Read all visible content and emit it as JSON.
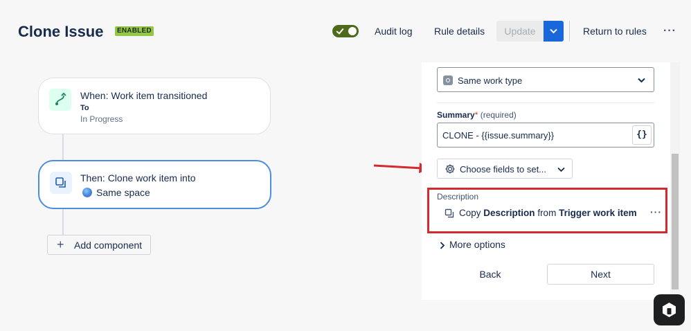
{
  "header": {
    "title": "Clone Issue",
    "status_badge": "ENABLED",
    "toggle_on": true,
    "audit_log": "Audit log",
    "rule_details": "Rule details",
    "update": "Update",
    "return_to_rules": "Return to rules",
    "more": "···"
  },
  "flow": {
    "trigger": {
      "title": "When: Work item transitioned",
      "sub_label": "To",
      "sub_value": "In Progress",
      "icon": "transition-icon"
    },
    "action": {
      "title": "Then: Clone work item into",
      "target": "Same space",
      "icon": "clone-icon"
    },
    "add_component": "Add component"
  },
  "panel": {
    "work_type": {
      "value": "Same work type"
    },
    "summary": {
      "label": "Summary",
      "required_star": "*",
      "required_text": "(required)",
      "value": "CLONE - {{issue.summary}}",
      "braces": "{}"
    },
    "choose_fields": "Choose fields to set...",
    "description": {
      "label": "Description",
      "copy": "Copy",
      "field": "Description",
      "from": "from",
      "source": "Trigger work item",
      "more": "···"
    },
    "more_options": "More options",
    "back": "Back",
    "next": "Next"
  },
  "colors": {
    "accent_blue": "#1868db",
    "highlight_red": "#d32a2f",
    "toggle_green": "#4d6a1c",
    "badge_green": "#94c748"
  }
}
